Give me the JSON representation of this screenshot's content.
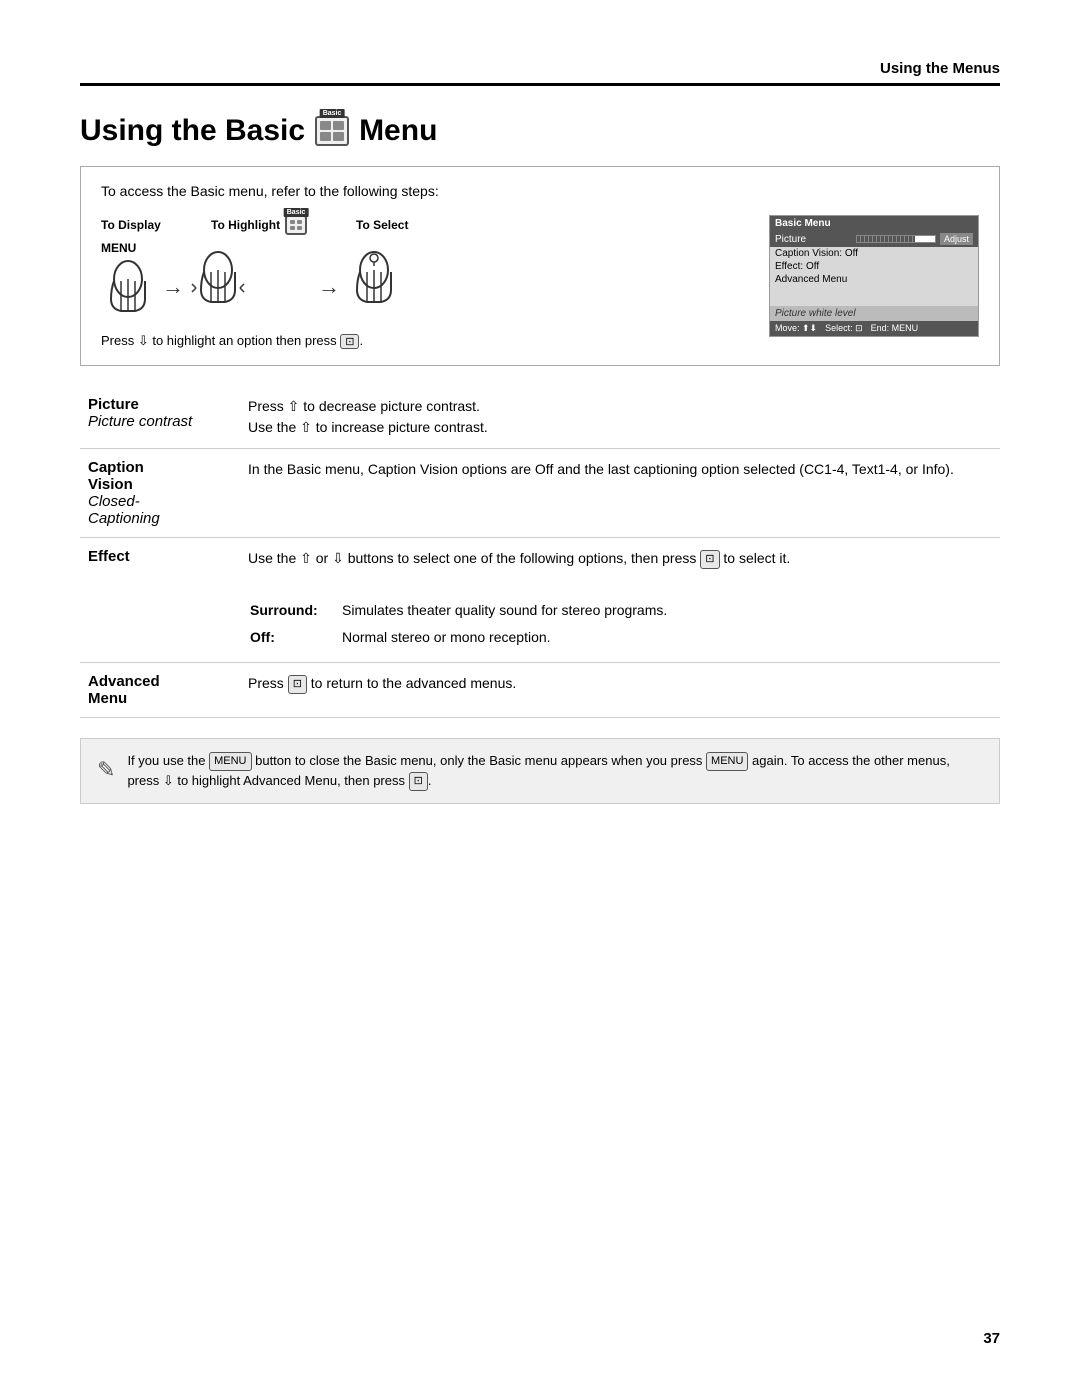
{
  "header": {
    "title": "Using the Menus"
  },
  "page_title": {
    "prefix": "Using the Basic",
    "suffix": "Menu"
  },
  "content_box": {
    "intro": "To access the Basic menu, refer to the following steps:",
    "step1_label": "To Display",
    "step2_label": "To Highlight",
    "step3_label": "To Select",
    "menu_label": "MENU",
    "note": "Press ⇩ to highlight an option then press ⊡."
  },
  "menu_screenshot": {
    "title": "Basic Menu",
    "items": [
      {
        "label": "Picture",
        "type": "progress",
        "highlighted": true
      },
      {
        "label": "Caption Vision: Off",
        "type": "plain"
      },
      {
        "label": "Effect: Off",
        "type": "plain"
      },
      {
        "label": "Advanced Menu",
        "type": "plain"
      }
    ],
    "status_label": "Picture white level",
    "bottom_bar": "Move: ⬆⬇⬅➡   Select: ⊡   End: MENU"
  },
  "table": {
    "rows": [
      {
        "label": "Picture",
        "label_sub": "Picture contrast",
        "content": "Press ⇧ to decrease picture contrast.\nUse the ⇧ to increase picture contrast."
      },
      {
        "label": "Caption Vision",
        "label_sub": "Closed-Captioning",
        "content": "In the Basic menu, Caption Vision options are Off and the last captioning option selected (CC1-4, Text1-4, or Info)."
      },
      {
        "label": "Effect",
        "content_main": "Use the ⇧ or ⇩ buttons to select one of the following options, then press ⊡ to select it.",
        "surround_label": "Surround:",
        "surround_text": "Simulates theater quality sound for stereo programs.",
        "off_label": "Off:",
        "off_text": "Normal stereo or mono reception."
      },
      {
        "label": "Advanced Menu",
        "content": "Press ⊡ to return to the advanced menus."
      }
    ]
  },
  "note": {
    "text1": "If you use the",
    "menu_icon": "MENU",
    "text2": "button to close the Basic menu, only the Basic menu appears when you press",
    "text3": "again. To access the other menus, press ⇩ to highlight Advanced Menu, then press ⊡."
  },
  "page_number": "37"
}
